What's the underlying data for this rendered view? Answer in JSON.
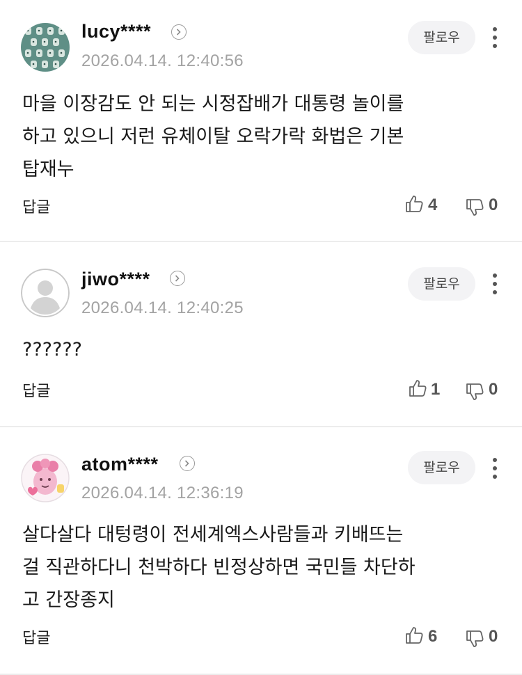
{
  "comments": [
    {
      "user": "lucy****",
      "date": "2026.04.14. 12:40:56",
      "follow_label": "팔로우",
      "text": "마을 이장감도 안 되는 시정잡배가 대통령 놀이를\n하고 있으니 저런 유체이탈 오락가락 화법은 기본\n탑재누",
      "reply_label": "답글",
      "likes": "4",
      "dislikes": "0",
      "avatar_icon": "pattern-avatar-icon"
    },
    {
      "user": "jiwo****",
      "date": "2026.04.14. 12:40:25",
      "follow_label": "팔로우",
      "text": "??????",
      "reply_label": "답글",
      "likes": "1",
      "dislikes": "0",
      "avatar_icon": "default-person-avatar-icon"
    },
    {
      "user": "atom****",
      "date": "2026.04.14. 12:36:19",
      "follow_label": "팔로우",
      "text": "살다살다 대텅령이 전세계엑스사람들과 키배뜨는\n걸 직관하다니 천박하다 빈정상하면 국민들 차단하\n고 간장종지",
      "reply_label": "답글",
      "likes": "6",
      "dislikes": "0",
      "avatar_icon": "pink-character-avatar-icon"
    }
  ],
  "colors": {
    "divider": "#ececec",
    "follow_bg": "#f3f3f5",
    "date": "#a3a3a3",
    "text": "#1a1a1a"
  }
}
